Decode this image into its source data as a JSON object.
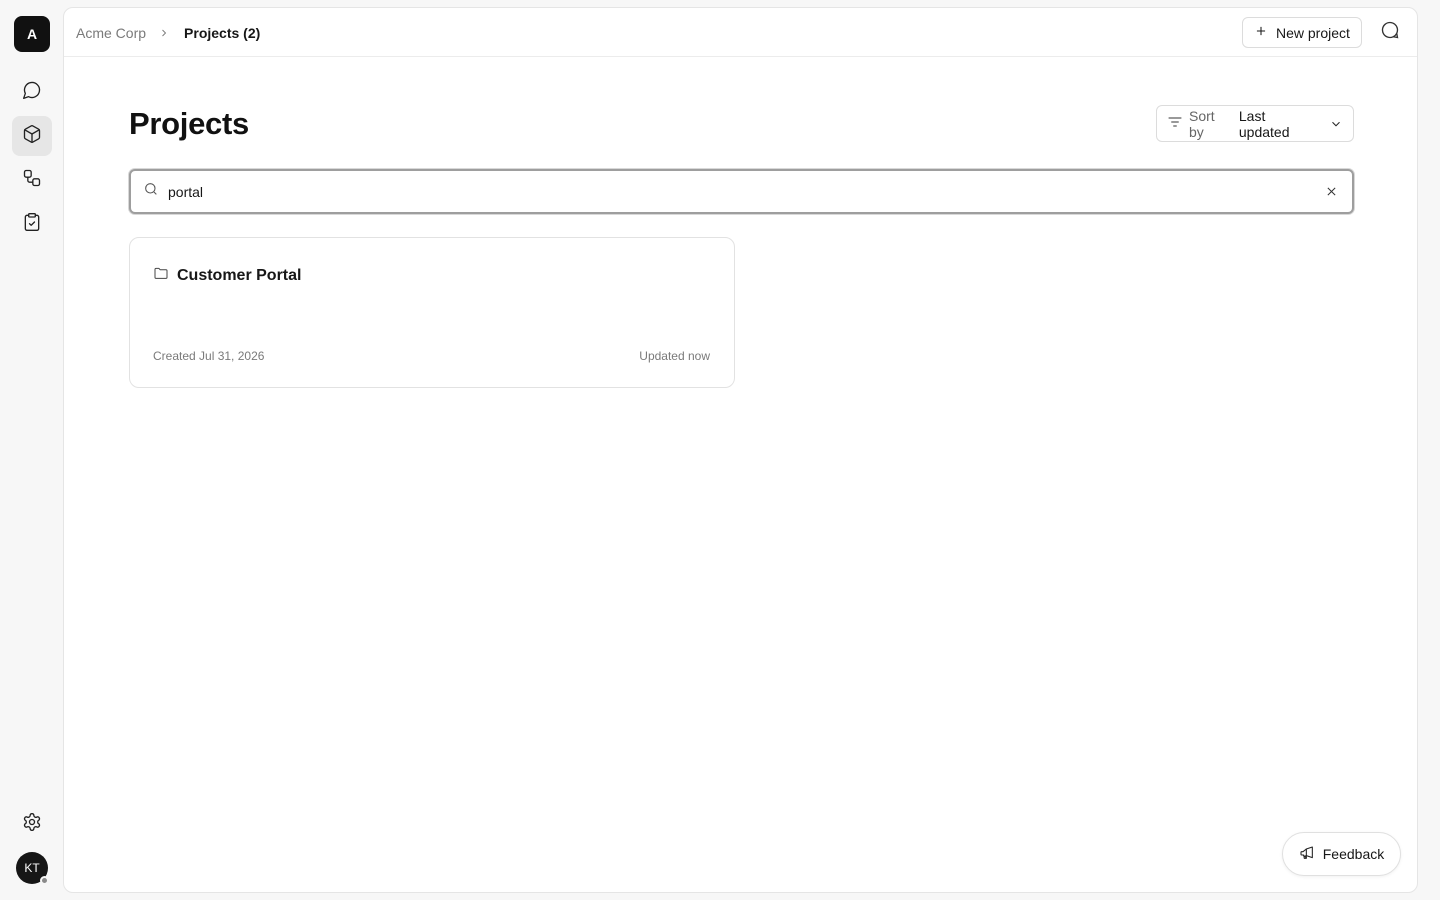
{
  "org": {
    "avatar_letter": "A"
  },
  "rail": {
    "items": [
      {
        "icon": "message-circle-icon",
        "active": false
      },
      {
        "icon": "box-icon",
        "active": true
      },
      {
        "icon": "workflow-icon",
        "active": false
      },
      {
        "icon": "clipboard-check-icon",
        "active": false
      }
    ],
    "settings_icon": "gear-icon"
  },
  "user": {
    "initials": "KT"
  },
  "breadcrumb": {
    "root": "Acme Corp",
    "current": "Projects (2)"
  },
  "header": {
    "new_project_label": "New project",
    "chat_icon": "chat-bubble-icon"
  },
  "page": {
    "title": "Projects"
  },
  "sort": {
    "prefix": "Sort by",
    "value": "Last updated"
  },
  "search": {
    "value": "portal",
    "placeholder": ""
  },
  "projects": [
    {
      "name": "Customer Portal",
      "created": "Created Jul 31, 2026",
      "updated": "Updated now"
    }
  ],
  "feedback": {
    "label": "Feedback"
  }
}
